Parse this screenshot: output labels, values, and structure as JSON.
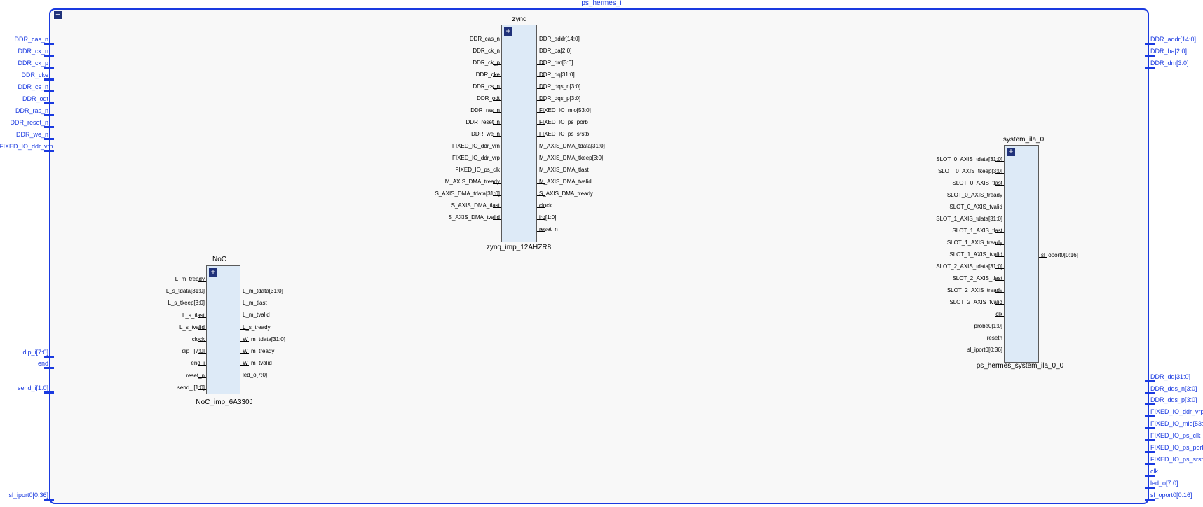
{
  "title": "ps_hermes_i",
  "left_ports": [
    "DDR_cas_n",
    "DDR_ck_n",
    "DDR_ck_p",
    "DDR_cke",
    "DDR_cs_n",
    "DDR_odt",
    "DDR_ras_n",
    "DDR_reset_n",
    "DDR_we_n",
    "FIXED_IO_ddr_vrn",
    "dip_i[7:0]",
    "end",
    "send_i[1:0]",
    "sl_iport0[0:36]"
  ],
  "right_ports": [
    "DDR_addr[14:0]",
    "DDR_ba[2:0]",
    "DDR_dm[3:0]",
    "DDR_dq[31:0]",
    "DDR_dqs_n[3:0]",
    "DDR_dqs_p[3:0]",
    "FIXED_IO_ddr_vrp",
    "FIXED_IO_mio[53:0]",
    "FIXED_IO_ps_clk",
    "FIXED_IO_ps_porb",
    "FIXED_IO_ps_srstb",
    "clk",
    "led_o[7:0]",
    "sl_oport0[0:16]"
  ],
  "zynq": {
    "name": "zynq",
    "instance": "zynq_imp_12AHZR8",
    "left": [
      "DDR_cas_n",
      "DDR_ck_n",
      "DDR_ck_p",
      "DDR_cke",
      "DDR_cs_n",
      "DDR_odt",
      "DDR_ras_n",
      "DDR_reset_n",
      "DDR_we_n",
      "FIXED_IO_ddr_vrn",
      "FIXED_IO_ddr_vrp",
      "FIXED_IO_ps_clk",
      "M_AXIS_DMA_tready",
      "S_AXIS_DMA_tdata[31:0]",
      "S_AXIS_DMA_tlast",
      "S_AXIS_DMA_tvalid"
    ],
    "right": [
      "DDR_addr[14:0]",
      "DDR_ba[2:0]",
      "DDR_dm[3:0]",
      "DDR_dq[31:0]",
      "DDR_dqs_n[3:0]",
      "DDR_dqs_p[3:0]",
      "FIXED_IO_mio[53:0]",
      "FIXED_IO_ps_porb",
      "FIXED_IO_ps_srstb",
      "M_AXIS_DMA_tdata[31:0]",
      "M_AXIS_DMA_tkeep[3:0]",
      "M_AXIS_DMA_tlast",
      "M_AXIS_DMA_tvalid",
      "S_AXIS_DMA_tready",
      "clock",
      "irq[1:0]",
      "reset_n"
    ]
  },
  "noc": {
    "name": "NoC",
    "instance": "NoC_imp_6A330J",
    "left": [
      "L_m_tready",
      "L_s_tdata[31:0]",
      "L_s_tkeep[3:0]",
      "L_s_tlast",
      "L_s_tvalid",
      "clock",
      "dip_i[7:0]",
      "end_i",
      "reset_n",
      "send_i[1:0]"
    ],
    "right": [
      "L_m_tdata[31:0]",
      "L_m_tlast",
      "L_m_tvalid",
      "L_s_tready",
      "W_m_tdata[31:0]",
      "W_m_tready",
      "W_m_tvalid",
      "led_o[7:0]"
    ]
  },
  "ila": {
    "name": "system_ila_0",
    "instance": "ps_hermes_system_ila_0_0",
    "left": [
      "SLOT_0_AXIS_tdata[31:0]",
      "SLOT_0_AXIS_tkeep[3:0]",
      "SLOT_0_AXIS_tlast",
      "SLOT_0_AXIS_tready",
      "SLOT_0_AXIS_tvalid",
      "SLOT_1_AXIS_tdata[31:0]",
      "SLOT_1_AXIS_tlast",
      "SLOT_1_AXIS_tready",
      "SLOT_1_AXIS_tvalid",
      "SLOT_2_AXIS_tdata[31:0]",
      "SLOT_2_AXIS_tlast",
      "SLOT_2_AXIS_tready",
      "SLOT_2_AXIS_tvalid",
      "clk",
      "probe0[1:0]",
      "resetn",
      "sl_iport0[0:36]"
    ],
    "right": [
      "sl_oport0[0:16]"
    ]
  },
  "colors": {
    "wire": "#1f7f1f",
    "port": "#1a3ae0",
    "block_fill": "#ddeaf7"
  }
}
